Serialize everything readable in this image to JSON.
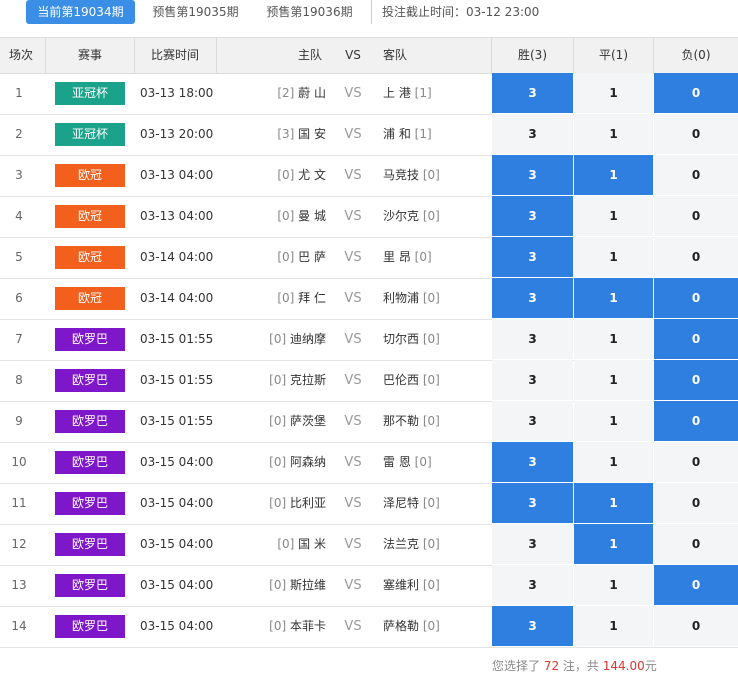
{
  "tabs": [
    {
      "label": "当前第19034期",
      "active": true
    },
    {
      "label": "预售第19035期",
      "active": false
    },
    {
      "label": "预售第19036期",
      "active": false
    }
  ],
  "deadline": "投注截止时间：03-12 23:00",
  "columns": {
    "index": "场次",
    "league": "赛事",
    "time": "比赛时间",
    "home": "主队",
    "vs": "VS",
    "away": "客队",
    "win": "胜(3)",
    "draw": "平(1)",
    "lose": "负(0)"
  },
  "colors": {
    "亚冠杯": "#1aa38a",
    "欧冠": "#f35f1c",
    "欧罗巴": "#7d17c9",
    "selected": "#2f7fe0"
  },
  "rows": [
    {
      "idx": "1",
      "league": "亚冠杯",
      "time": "03-13 18:00",
      "home_rank": "[2]",
      "home": "蔚 山",
      "vs": "VS",
      "away": "上 港",
      "away_rank": "[1]",
      "win": "3",
      "draw": "1",
      "lose": "0",
      "sel": [
        true,
        false,
        true
      ]
    },
    {
      "idx": "2",
      "league": "亚冠杯",
      "time": "03-13 20:00",
      "home_rank": "[3]",
      "home": "国 安",
      "vs": "VS",
      "away": "浦 和",
      "away_rank": "[1]",
      "win": "3",
      "draw": "1",
      "lose": "0",
      "sel": [
        false,
        false,
        false
      ]
    },
    {
      "idx": "3",
      "league": "欧冠",
      "time": "03-13 04:00",
      "home_rank": "[0]",
      "home": "尤 文",
      "vs": "VS",
      "away": "马竞技",
      "away_rank": "[0]",
      "win": "3",
      "draw": "1",
      "lose": "0",
      "sel": [
        true,
        true,
        false
      ]
    },
    {
      "idx": "4",
      "league": "欧冠",
      "time": "03-13 04:00",
      "home_rank": "[0]",
      "home": "曼 城",
      "vs": "VS",
      "away": "沙尔克",
      "away_rank": "[0]",
      "win": "3",
      "draw": "1",
      "lose": "0",
      "sel": [
        true,
        false,
        false
      ]
    },
    {
      "idx": "5",
      "league": "欧冠",
      "time": "03-14 04:00",
      "home_rank": "[0]",
      "home": "巴 萨",
      "vs": "VS",
      "away": "里 昂",
      "away_rank": "[0]",
      "win": "3",
      "draw": "1",
      "lose": "0",
      "sel": [
        true,
        false,
        false
      ]
    },
    {
      "idx": "6",
      "league": "欧冠",
      "time": "03-14 04:00",
      "home_rank": "[0]",
      "home": "拜 仁",
      "vs": "VS",
      "away": "利物浦",
      "away_rank": "[0]",
      "win": "3",
      "draw": "1",
      "lose": "0",
      "sel": [
        true,
        true,
        true
      ]
    },
    {
      "idx": "7",
      "league": "欧罗巴",
      "time": "03-15 01:55",
      "home_rank": "[0]",
      "home": "迪纳摩",
      "vs": "VS",
      "away": "切尔西",
      "away_rank": "[0]",
      "win": "3",
      "draw": "1",
      "lose": "0",
      "sel": [
        false,
        false,
        true
      ]
    },
    {
      "idx": "8",
      "league": "欧罗巴",
      "time": "03-15 01:55",
      "home_rank": "[0]",
      "home": "克拉斯",
      "vs": "VS",
      "away": "巴伦西",
      "away_rank": "[0]",
      "win": "3",
      "draw": "1",
      "lose": "0",
      "sel": [
        false,
        false,
        true
      ]
    },
    {
      "idx": "9",
      "league": "欧罗巴",
      "time": "03-15 01:55",
      "home_rank": "[0]",
      "home": "萨茨堡",
      "vs": "VS",
      "away": "那不勒",
      "away_rank": "[0]",
      "win": "3",
      "draw": "1",
      "lose": "0",
      "sel": [
        false,
        false,
        true
      ]
    },
    {
      "idx": "10",
      "league": "欧罗巴",
      "time": "03-15 04:00",
      "home_rank": "[0]",
      "home": "阿森纳",
      "vs": "VS",
      "away": "雷 恩",
      "away_rank": "[0]",
      "win": "3",
      "draw": "1",
      "lose": "0",
      "sel": [
        true,
        false,
        false
      ]
    },
    {
      "idx": "11",
      "league": "欧罗巴",
      "time": "03-15 04:00",
      "home_rank": "[0]",
      "home": "比利亚",
      "vs": "VS",
      "away": "泽尼特",
      "away_rank": "[0]",
      "win": "3",
      "draw": "1",
      "lose": "0",
      "sel": [
        true,
        true,
        false
      ]
    },
    {
      "idx": "12",
      "league": "欧罗巴",
      "time": "03-15 04:00",
      "home_rank": "[0]",
      "home": "国 米",
      "vs": "VS",
      "away": "法兰克",
      "away_rank": "[0]",
      "win": "3",
      "draw": "1",
      "lose": "0",
      "sel": [
        false,
        true,
        false
      ]
    },
    {
      "idx": "13",
      "league": "欧罗巴",
      "time": "03-15 04:00",
      "home_rank": "[0]",
      "home": "斯拉维",
      "vs": "VS",
      "away": "塞维利",
      "away_rank": "[0]",
      "win": "3",
      "draw": "1",
      "lose": "0",
      "sel": [
        false,
        false,
        true
      ]
    },
    {
      "idx": "14",
      "league": "欧罗巴",
      "time": "03-15 04:00",
      "home_rank": "[0]",
      "home": "本菲卡",
      "vs": "VS",
      "away": "萨格勒",
      "away_rank": "[0]",
      "win": "3",
      "draw": "1",
      "lose": "0",
      "sel": [
        true,
        false,
        false
      ]
    }
  ],
  "summary": {
    "prefix": "您选择了 ",
    "count": "72",
    "mid": " 注，共 ",
    "amount": "144.00",
    "suffix": "元"
  }
}
